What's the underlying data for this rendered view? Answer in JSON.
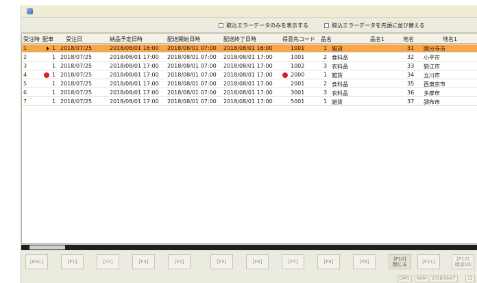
{
  "options": {
    "show_errors_only": "取込エラーデータのみを表示する",
    "sort_errors_first": "取込エラーデータを先頭に並び替える"
  },
  "columns": [
    "受注時",
    "配車",
    "受注日",
    "納品予定日時",
    "配送開始日時",
    "配送終了日時",
    "得意先コード",
    "品名",
    "品名1",
    "地名",
    "地名1"
  ],
  "rows": [
    {
      "no": "1",
      "flag": "1",
      "order_date": "2018/07/25",
      "delivery": "2018/08/01 16:00",
      "start": "2018/08/01 07:00",
      "end": "2018/08/01 16:00",
      "customer": "1001",
      "item_no": "1",
      "item": "雑貨",
      "area_no": "31",
      "area": "国分寺市",
      "selected": true,
      "error": false
    },
    {
      "no": "2",
      "flag": "1",
      "order_date": "2018/07/25",
      "delivery": "2018/08/01 17:00",
      "start": "2018/08/01 07:00",
      "end": "2018/08/01 17:00",
      "customer": "1001",
      "item_no": "2",
      "item": "食料品",
      "area_no": "32",
      "area": "小平市",
      "selected": false,
      "error": false
    },
    {
      "no": "3",
      "flag": "1",
      "order_date": "2018/07/25",
      "delivery": "2018/08/01 17:00",
      "start": "2018/08/01 07:00",
      "end": "2018/08/01 17:00",
      "customer": "1002",
      "item_no": "3",
      "item": "衣料品",
      "area_no": "33",
      "area": "狛江市",
      "selected": false,
      "error": false
    },
    {
      "no": "4",
      "flag": "1",
      "order_date": "2018/07/25",
      "delivery": "2018/08/01 17:00",
      "start": "2018/08/01 07:00",
      "end": "2018/08/01 17:00",
      "customer": "2000",
      "item_no": "1",
      "item": "雑貨",
      "area_no": "34",
      "area": "立川市",
      "selected": false,
      "error": true
    },
    {
      "no": "5",
      "flag": "1",
      "order_date": "2018/07/25",
      "delivery": "2018/08/01 17:00",
      "start": "2018/08/01 07:00",
      "end": "2018/08/01 17:00",
      "customer": "2001",
      "item_no": "2",
      "item": "食料品",
      "area_no": "35",
      "area": "西東京市",
      "selected": false,
      "error": false
    },
    {
      "no": "6",
      "flag": "1",
      "order_date": "2018/07/25",
      "delivery": "2018/08/01 17:00",
      "start": "2018/08/01 07:00",
      "end": "2018/08/01 17:00",
      "customer": "3001",
      "item_no": "3",
      "item": "衣料品",
      "area_no": "36",
      "area": "多摩市",
      "selected": false,
      "error": false
    },
    {
      "no": "7",
      "flag": "1",
      "order_date": "2018/07/25",
      "delivery": "2018/08/01 17:00",
      "start": "2018/08/01 07:00",
      "end": "2018/08/01 17:00",
      "customer": "5001",
      "item_no": "1",
      "item": "雑貨",
      "area_no": "37",
      "area": "調布市",
      "selected": false,
      "error": false
    }
  ],
  "fkeys": [
    {
      "label": "[ESC]",
      "active": false
    },
    {
      "label": "[F1]",
      "active": false
    },
    {
      "label": "[F2]",
      "active": false
    },
    {
      "label": "[F3]",
      "active": false
    },
    {
      "label": "[F4]",
      "active": false
    },
    {
      "label": "[F5]",
      "active": false
    },
    {
      "label": "[F6]",
      "active": false
    },
    {
      "label": "[F7]",
      "active": false
    },
    {
      "label": "[F8]",
      "active": false
    },
    {
      "label": "[F9]",
      "active": false
    },
    {
      "label": "[F10]\n閉じる",
      "active": true
    },
    {
      "label": "[F11]",
      "active": false
    },
    {
      "label": "[F12]\n確認OK",
      "active": false
    }
  ],
  "status": {
    "caps": "CAPS",
    "num": "NUM",
    "date": "2018/08/07",
    "time": "12"
  },
  "colors": {
    "selected_row": "#f7a64a",
    "error_icon": "#d2231e"
  }
}
